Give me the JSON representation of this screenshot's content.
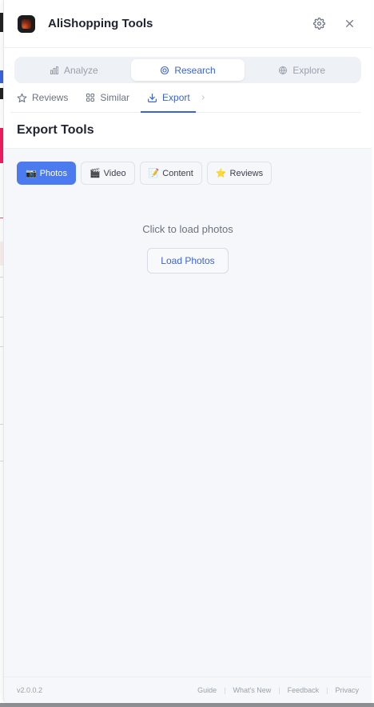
{
  "app": {
    "title": "AliShopping Tools"
  },
  "mode_tabs": [
    {
      "label": "Analyze",
      "icon": "bar-chart-icon",
      "active": false
    },
    {
      "label": "Research",
      "icon": "target-icon",
      "active": true
    },
    {
      "label": "Explore",
      "icon": "globe-icon",
      "active": false
    }
  ],
  "sub_tabs": [
    {
      "label": "Reviews",
      "icon": "star-icon",
      "active": false
    },
    {
      "label": "Similar",
      "icon": "grid-icon",
      "active": false
    },
    {
      "label": "Export",
      "icon": "download-icon",
      "active": true
    }
  ],
  "section": {
    "title": "Export Tools"
  },
  "export_chips": [
    {
      "emoji": "📷",
      "label": "Photos",
      "active": true
    },
    {
      "emoji": "🎬",
      "label": "Video",
      "active": false
    },
    {
      "emoji": "📝",
      "label": "Content",
      "active": false
    },
    {
      "emoji": "⭐",
      "label": "Reviews",
      "active": false
    }
  ],
  "empty_state": {
    "message": "Click to load photos",
    "button_label": "Load Photos"
  },
  "footer": {
    "version": "v2.0.0.2",
    "links": [
      "Guide",
      "What's New",
      "Feedback",
      "Privacy"
    ]
  },
  "colors": {
    "accent": "#3b63d9",
    "chip_active": "#4c7bf0",
    "panel_bg": "#f5f7fa"
  }
}
